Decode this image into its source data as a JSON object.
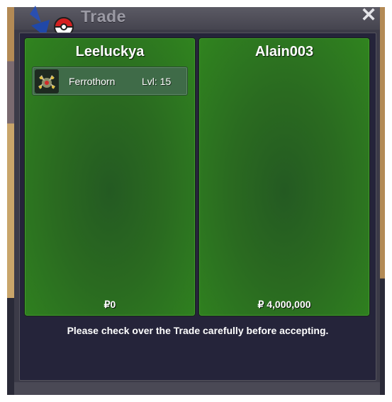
{
  "window": {
    "title": "Trade",
    "title_icon": "pokeball-arrows-icon",
    "close_label": "✕"
  },
  "left_panel": {
    "player_name": "Leeluckya",
    "items": [
      {
        "icon": "ferrothorn-icon",
        "name": "Ferrothorn",
        "level_text": "Lvl: 15"
      }
    ],
    "money": "₽0"
  },
  "right_panel": {
    "player_name": "Alain003",
    "items": [],
    "money": "₽ 4,000,000"
  },
  "notice": "Please check over the Trade carefully before accepting.",
  "colors": {
    "panel_green": "#2a6a20",
    "window_bg": "#3c3b48",
    "inner_bg": "#25243a",
    "title_text": "#9b9aa4"
  }
}
